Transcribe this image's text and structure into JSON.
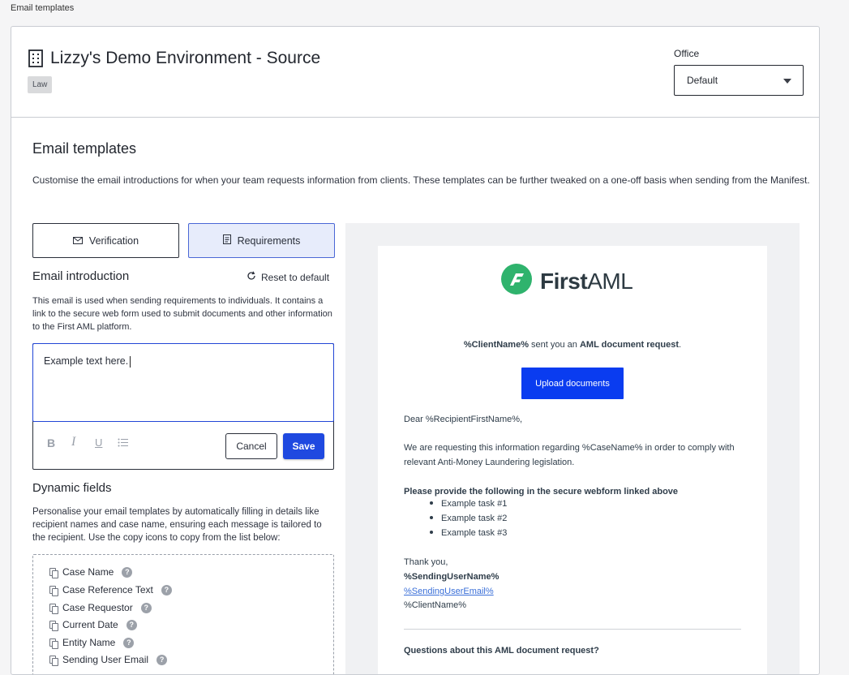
{
  "breadcrumb": "Email templates",
  "header": {
    "org_name": "Lizzy's Demo Environment - Source",
    "tag": "Law",
    "office_label": "Office",
    "office_value": "Default"
  },
  "section": {
    "title": "Email templates",
    "description": "Customise the email introductions for when your team requests information from clients. These templates can be further tweaked on a one-off basis when sending from the Manifest."
  },
  "tabs": [
    {
      "label": "Verification",
      "icon": "envelope-icon",
      "active": false
    },
    {
      "label": "Requirements",
      "icon": "document-icon",
      "active": true
    }
  ],
  "intro": {
    "title": "Email introduction",
    "reset_label": "Reset to default",
    "description": "This email is used when sending requirements to individuals. It contains a link to the secure web form used to submit documents and other information to the First AML platform.",
    "editor_text": "Example text here.",
    "cancel_label": "Cancel",
    "save_label": "Save"
  },
  "dynamic": {
    "title": "Dynamic fields",
    "description": "Personalise your email templates by automatically filling in details like recipient names and case name, ensuring each message is tailored to the recipient. Use the copy icons to copy from the list below:",
    "items": [
      "Case Name",
      "Case Reference Text",
      "Case Requestor",
      "Current Date",
      "Entity Name",
      "Sending User Email"
    ]
  },
  "preview": {
    "logo_bold": "First",
    "logo_light": "AML",
    "request_client": "%ClientName%",
    "request_mid": " sent you an ",
    "request_bold": "AML document request",
    "request_end": ".",
    "upload_label": "Upload documents",
    "greeting": "Dear %RecipientFirstName%,",
    "body": "We are requesting this information regarding %CaseName% in order to comply with relevant Anti-Money Laundering legislation.",
    "list_heading": "Please provide the following in the secure webform linked above",
    "tasks": [
      "Example task #1",
      "Example task #2",
      "Example task #3"
    ],
    "thanks": "Thank you,",
    "sender_name": "%SendingUserName%",
    "sender_email": "%SendingUserEmail%",
    "client_name": "%ClientName%",
    "questions": "Questions about this AML document request?"
  },
  "colors": {
    "primary": "#1f49e0",
    "logo_green": "#2fb36d",
    "active_tab_bg": "#e7ecfb"
  }
}
